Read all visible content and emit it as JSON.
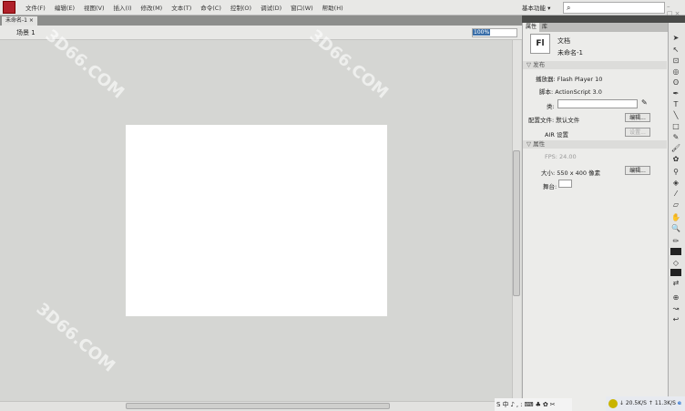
{
  "menubar": {
    "items": [
      "文件(F)",
      "编辑(E)",
      "视图(V)",
      "插入(I)",
      "修改(M)",
      "文本(T)",
      "命令(C)",
      "控制(O)",
      "调试(D)",
      "窗口(W)",
      "帮助(H)"
    ],
    "workspace": "基本功能 ▾",
    "search_icon": "⌕"
  },
  "document": {
    "tab": "未命名-1",
    "tab_close": "×",
    "scene": "场景 1",
    "zoom": "100%"
  },
  "panel": {
    "tabs": [
      "属性",
      "库"
    ],
    "doc_type": "文档",
    "doc_name": "未命名-1",
    "logo": "Fl",
    "publish": {
      "title": "发布",
      "player": "播放器: Flash Player 10",
      "script": "脚本: ActionScript 3.0",
      "class_label": "类:",
      "profile": "配置文件: 默认文件",
      "edit": "编辑...",
      "air": "AIR 设置",
      "air_btn": "设置..."
    },
    "properties": {
      "title": "属性",
      "fps": "FPS: 24.00",
      "size": "大小: 550 x 400 像素",
      "edit": "编辑...",
      "stage": "舞台:",
      "stage_color": "#ffffff"
    }
  },
  "taskbar": {
    "ime": "S中♪,:⌨♣✿✂"
  },
  "tray": {
    "down": "↓ 20.5K/S",
    "up": "↑ 11.3K/S"
  },
  "watermark": "3D66.COM"
}
